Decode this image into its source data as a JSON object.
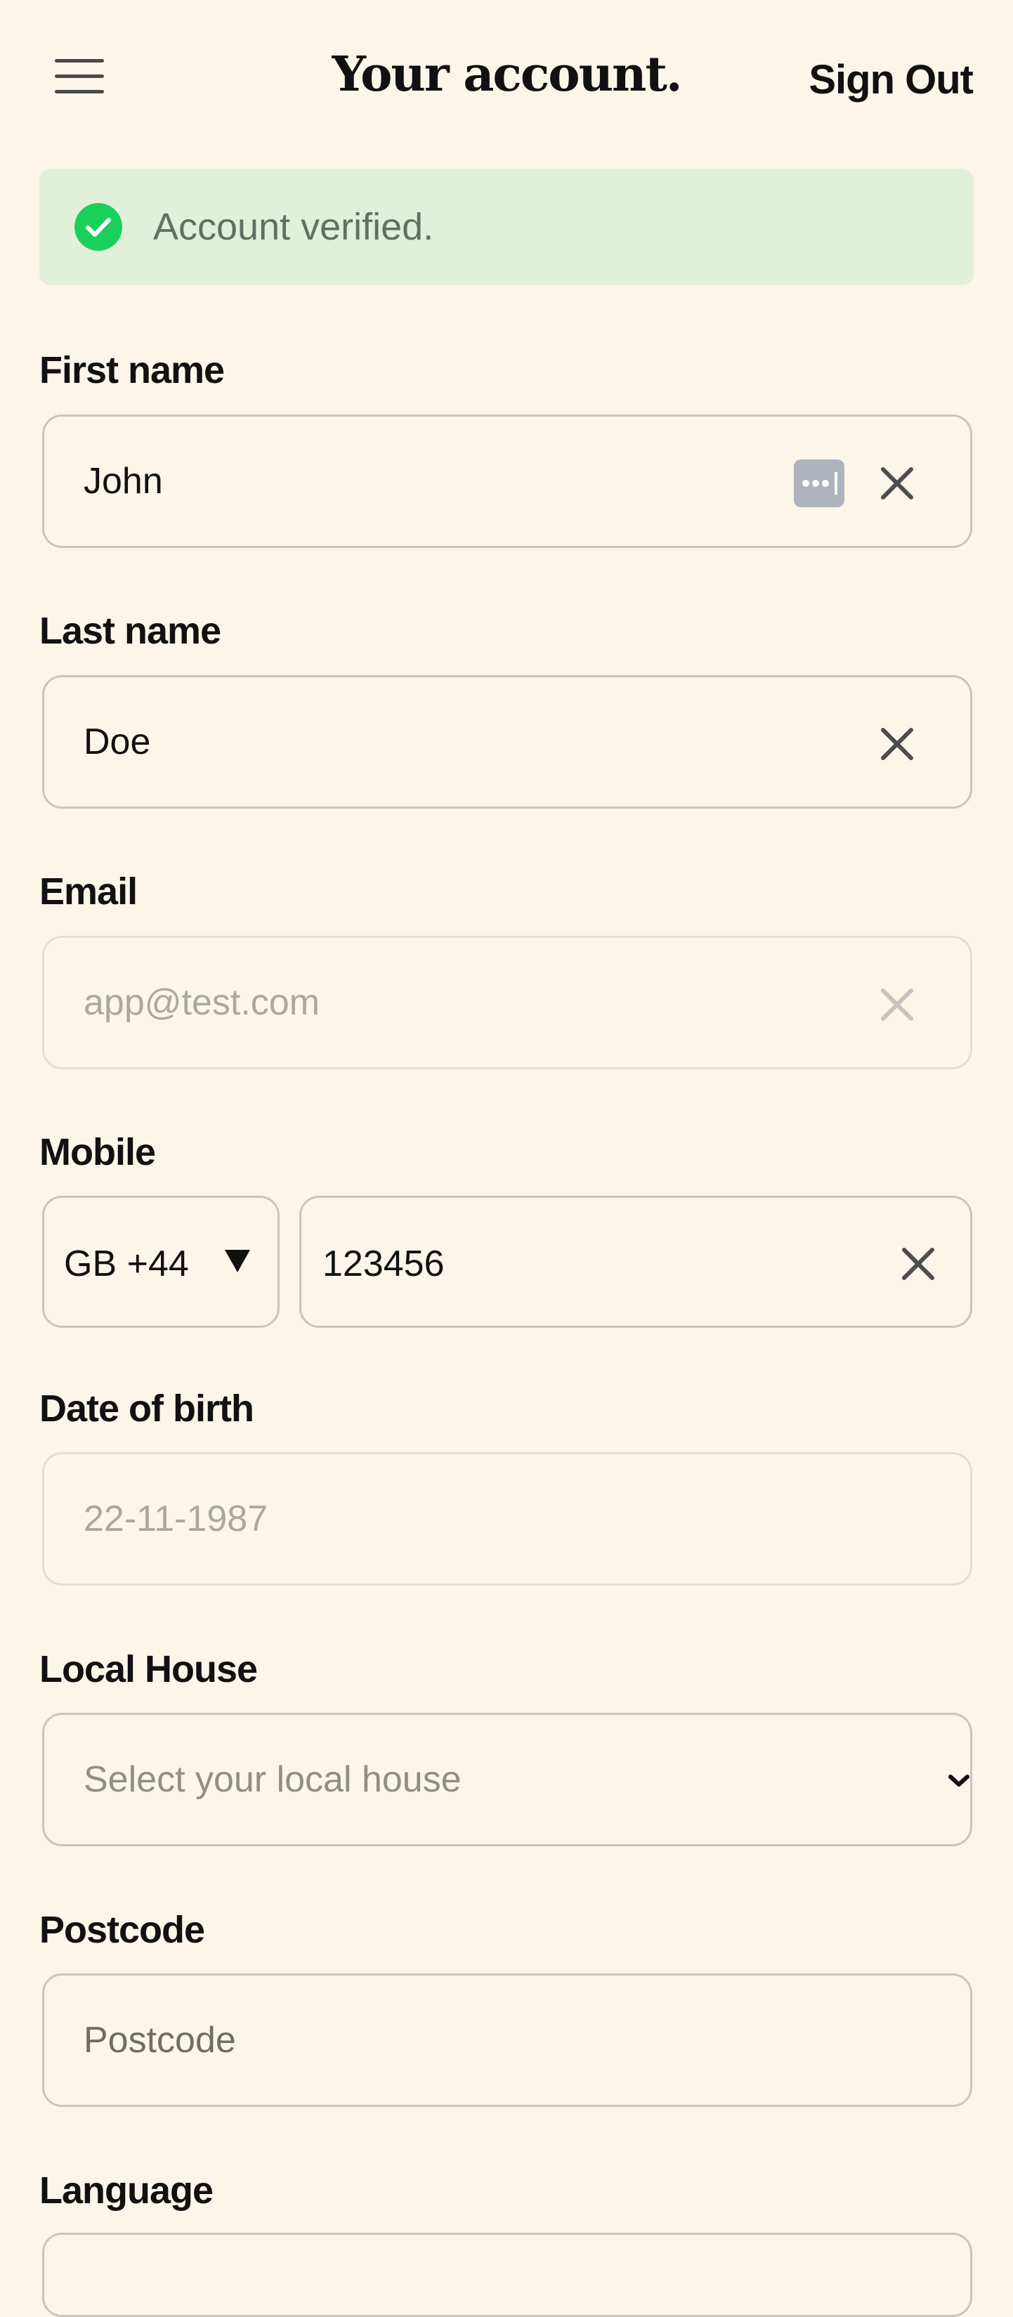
{
  "header": {
    "title": "Your account.",
    "signout_label": "Sign Out",
    "menu_icon": "hamburger-menu-icon"
  },
  "banner": {
    "text": "Account verified.",
    "icon": "check-circle-icon",
    "color": "#19d15a"
  },
  "fields": {
    "first_name": {
      "label": "First name",
      "value": "John"
    },
    "last_name": {
      "label": "Last name",
      "value": "Doe"
    },
    "email": {
      "label": "Email",
      "value": "app@test.com",
      "disabled": true
    },
    "mobile": {
      "label": "Mobile",
      "country": "GB +44",
      "value": "123456"
    },
    "dob": {
      "label": "Date of birth",
      "value": "22-11-1987",
      "disabled": true
    },
    "local_house": {
      "label": "Local House",
      "placeholder": "Select your local house"
    },
    "postcode": {
      "label": "Postcode",
      "placeholder": "Postcode"
    },
    "language": {
      "label": "Language"
    }
  },
  "colors": {
    "background": "#fbf6e8",
    "banner_bg": "#e3f0d9",
    "border": "#c9c6ba"
  }
}
